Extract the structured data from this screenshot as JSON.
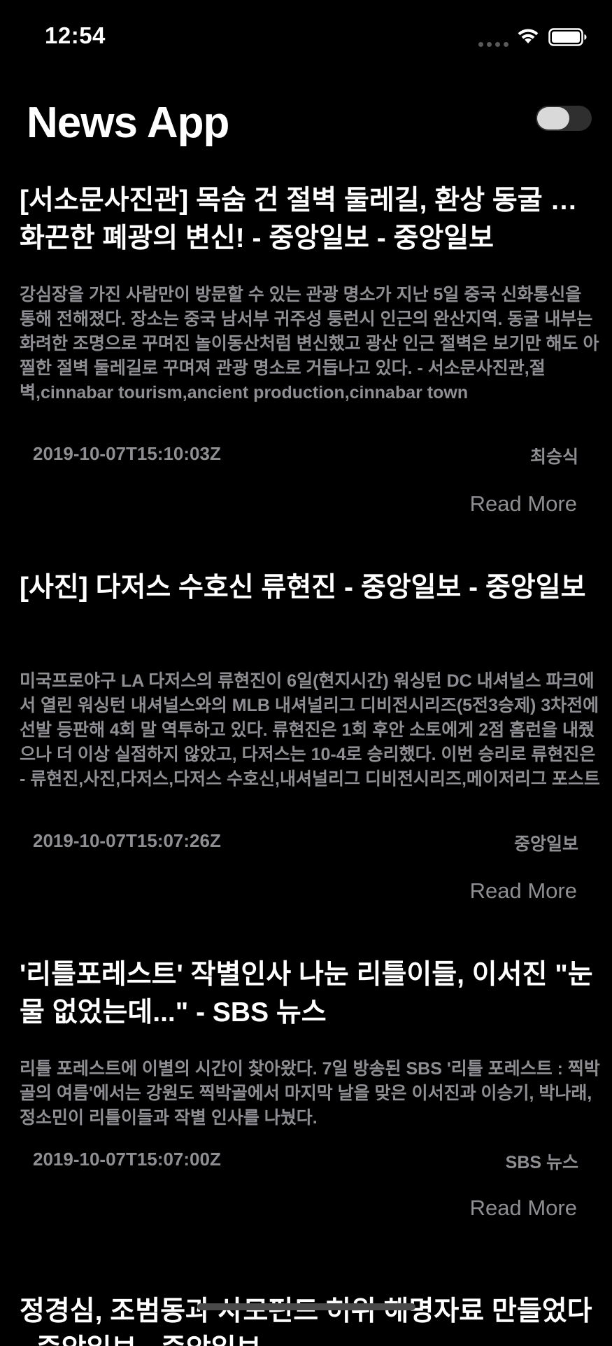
{
  "status_bar": {
    "time": "12:54"
  },
  "header": {
    "title": "News App",
    "toggle_state": "on"
  },
  "articles": [
    {
      "title": "[서소문사진관] 목숨 건 절벽 둘레길, 환상 동굴 … 화끈한 폐광의 변신! - 중앙일보 - 중앙일보",
      "description": "강심장을 가진 사람만이 방문할 수 있는 관광 명소가 지난 5일 중국 신화통신을 통해 전해졌다. 장소는 중국 남서부 귀주성 퉁런시 인근의 완산지역. 동굴 내부는 화려한 조명으로 꾸며진 놀이동산처럼 변신했고 광산 인근 절벽은 보기만 해도 아찔한 절벽 둘레길로 꾸며져 관광 명소로 거듭나고 있다. - 서소문사진관,절벽,cinnabar tourism,ancient production,cinnabar town",
      "date": "2019-10-07T15:10:03Z",
      "source": "최승식",
      "read_more": "Read More"
    },
    {
      "title": "[사진] 다저스 수호신 류현진 - 중앙일보 - 중앙일보",
      "description": "미국프로야구 LA 다저스의 류현진이 6일(현지시간) 워싱턴 DC 내셔널스 파크에서 열린 워싱턴 내셔널스와의 MLB 내셔널리그 디비전시리즈(5전3승제) 3차전에 선발 등판해 4회 말 역투하고 있다. 류현진은 1회 후안 소토에게 2점 홈런을 내줬으나 더 이상 실점하지 않았고, 다저스는 10-4로 승리했다. 이번 승리로 류현진은  - 류현진,사진,다저스,다저스 수호신,내셔널리그 디비전시리즈,메이저리그 포스트시즌",
      "date": "2019-10-07T15:07:26Z",
      "source": "중앙일보",
      "read_more": "Read More"
    },
    {
      "title": "'리틀포레스트' 작별인사 나눈 리틀이들, 이서진 \"눈물 없었는데...\" - SBS 뉴스",
      "description": "리틀 포레스트에 이별의 시간이 찾아왔다. 7일 방송된 SBS '리틀 포레스트 : 찍박골의 여름'에서는 강원도 찍박골에서 마지막 날을 맞은 이서진과 이승기, 박나래, 정소민이 리틀이들과 작별 인사를 나눴다.",
      "date": "2019-10-07T15:07:00Z",
      "source": "SBS 뉴스",
      "read_more": "Read More"
    },
    {
      "title": "정경심, 조범동과 사모펀드 허위 해명자료 만들었다 - 중앙일보 - 중앙일보",
      "description": "",
      "date": "",
      "source": "",
      "read_more": ""
    }
  ]
}
